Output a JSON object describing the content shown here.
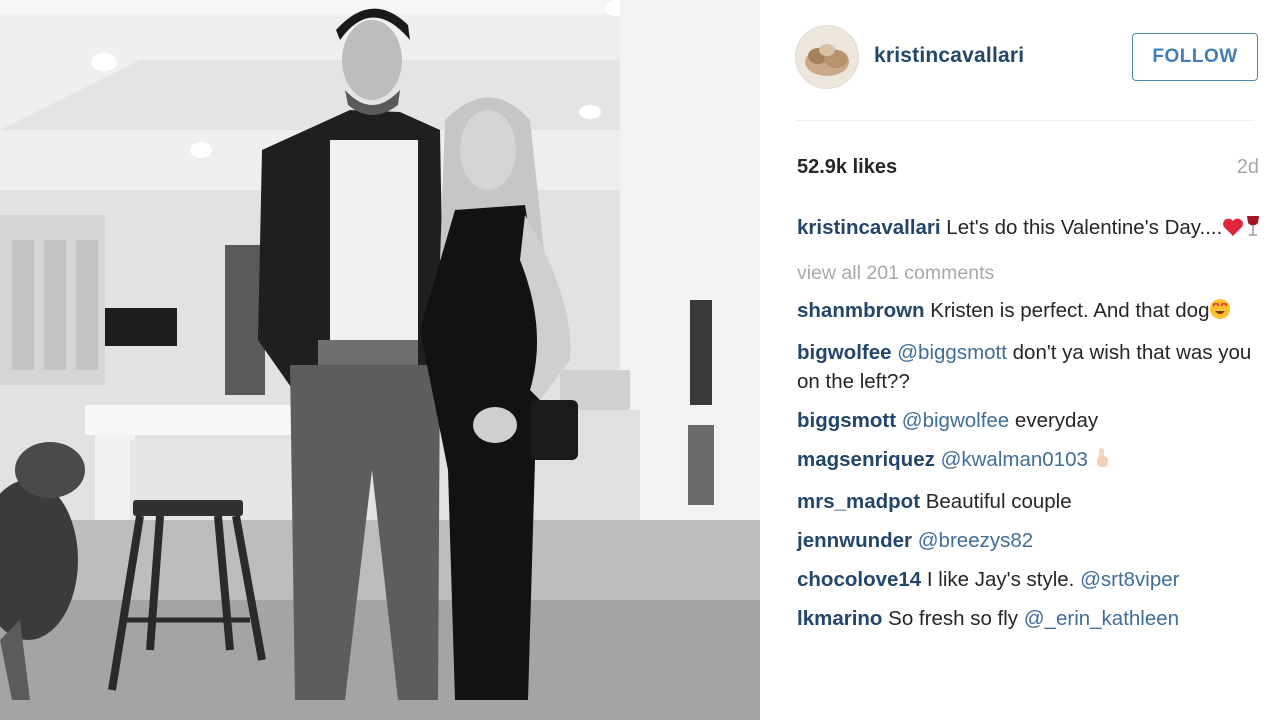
{
  "post": {
    "photo_alt": "Black and white photo of a couple standing in a kitchen with a dog",
    "username": "kristincavallari",
    "follow_label": "FOLLOW",
    "likes": "52.9k likes",
    "time_ago": "2d",
    "caption": {
      "user": "kristincavallari",
      "text": "Let's do this Valentine's Day....",
      "emojis": [
        "heart-emoji",
        "wine-glass-emoji"
      ]
    },
    "view_all": "view all 201 comments",
    "comments": [
      {
        "user": "shanmbrown",
        "text": "Kristen is perfect. And that dog",
        "emoji": "heart-eyes-emoji"
      },
      {
        "user": "bigwolfee",
        "mention": "@biggsmott",
        "text": "don't ya wish that was you on the left??"
      },
      {
        "user": "biggsmott",
        "mention": "@bigwolfee",
        "text": "everyday"
      },
      {
        "user": "magsenriquez",
        "mention": "@kwalman0103",
        "emoji": "pointing-hand-emoji"
      },
      {
        "user": "mrs_madpot",
        "text": "Beautiful couple"
      },
      {
        "user": "jennwunder",
        "mention": "@breezys82"
      },
      {
        "user": "chocolove14",
        "text": "I like Jay's style.",
        "mention": "@srt8viper"
      },
      {
        "user": "lkmarino",
        "text": "So fresh so fly",
        "mention": "@_erin_kathleen"
      }
    ]
  },
  "colors": {
    "username": "#22476b",
    "mention": "#3f6e98",
    "follow": "#3f7fb5",
    "muted": "#a8a8a8",
    "text": "#262626"
  }
}
